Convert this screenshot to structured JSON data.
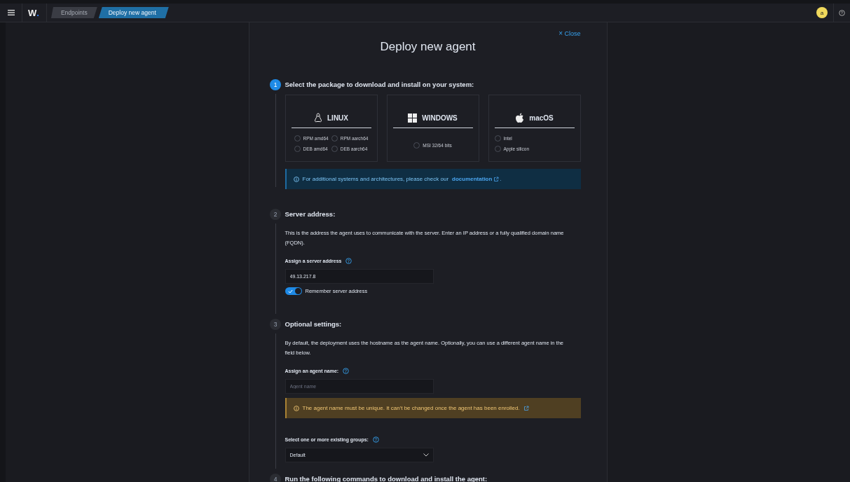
{
  "header": {
    "logo": {
      "letter": "W",
      "dot": "."
    },
    "breadcrumbs": [
      {
        "label": "Endpoints",
        "selected": false
      },
      {
        "label": "Deploy new agent",
        "selected": true
      }
    ],
    "avatar": "a"
  },
  "panel": {
    "close": {
      "icon": "×",
      "label": "Close"
    },
    "title": "Deploy new agent",
    "steps": [
      {
        "number": "1",
        "active": true,
        "kind": "packages",
        "title": "Select the package to download and install on your system:",
        "os_cards": [
          {
            "kind": "linux",
            "label": "LINUX",
            "options": [
              {
                "label": "RPM amd64",
                "selected": false
              },
              {
                "label": "RPM aarch64",
                "selected": false
              },
              {
                "label": "DEB amd64",
                "selected": false
              },
              {
                "label": "DEB aarch64",
                "selected": false
              }
            ]
          },
          {
            "kind": "windows",
            "label": "WINDOWS",
            "options": [
              {
                "label": "MSI 32/64 bits",
                "selected": false
              }
            ]
          },
          {
            "kind": "macos",
            "label": "macOS",
            "options": [
              {
                "label": "Intel",
                "selected": false
              },
              {
                "label": "Apple silicon",
                "selected": false
              }
            ]
          }
        ],
        "callout": {
          "kind": "info",
          "text": "For additional systems and architectures, please check our ",
          "link": "documentation",
          "after": "."
        }
      },
      {
        "number": "2",
        "active": false,
        "kind": "server",
        "title": "Server address:",
        "description": "This is the address the agent uses to communicate with the server. Enter an IP address or a fully qualified domain name (FQDN).",
        "field_label": "Assign a server address",
        "value": "49.13.217.8",
        "toggle": {
          "label": "Remember server address",
          "on": true
        }
      },
      {
        "number": "3",
        "active": false,
        "kind": "optional",
        "title": "Optional settings:",
        "description": "By default, the deployment uses the hostname as the agent name. Optionally, you can use a different agent name in the field below.",
        "field_label": "Assign an agent name:",
        "placeholder": "Agent name",
        "callout": {
          "kind": "warning",
          "text": "The agent name must be unique. It can't be changed once the agent has been enrolled."
        },
        "select_label": "Select one or more existing groups:",
        "select_value": "Default"
      },
      {
        "number": "4",
        "active": false,
        "kind": "commands",
        "title": "Run the following commands to download and install the agent:"
      }
    ]
  }
}
